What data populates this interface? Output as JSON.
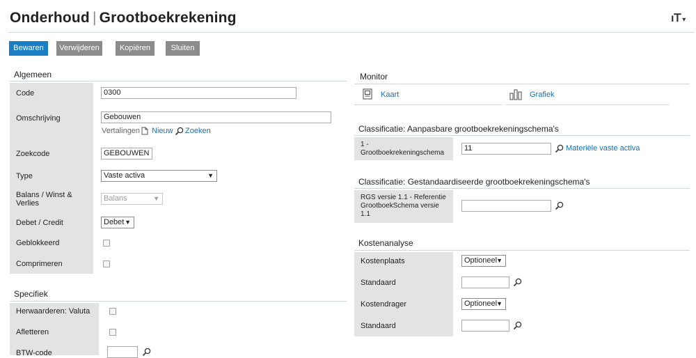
{
  "header": {
    "title_part1": "Onderhoud",
    "title_sep": "|",
    "title_part2": "Grootboekrekening",
    "tools_icon": "settings-tools-icon",
    "tools_caret": "▾"
  },
  "toolbar": {
    "save": "Bewaren",
    "delete": "Verwijderen",
    "copy": "Kopiëren",
    "close": "Sluiten"
  },
  "algemeen": {
    "title": "Algemeen",
    "code_label": "Code",
    "code_value": "0300",
    "omschrijving_label": "Omschrijving",
    "omschrijving_value": "Gebouwen",
    "vertalingen": "Vertalingen",
    "nieuw": "Nieuw",
    "zoeken": "Zoeken",
    "zoekcode_label": "Zoekcode",
    "zoekcode_value": "GEBOUWEN",
    "type_label": "Type",
    "type_value": "Vaste activa",
    "balans_label_1": "Balans / Winst &",
    "balans_label_2": "Verlies",
    "balans_value": "Balans",
    "debet_label": "Debet / Credit",
    "debet_value": "Debet",
    "geblokkeerd_label": "Geblokkeerd",
    "comprimeren_label": "Comprimeren"
  },
  "specifiek": {
    "title": "Specifiek",
    "herwaarderen_label": "Herwaarderen: Valuta",
    "afletteren_label": "Afletteren",
    "btw_label": "BTW-code"
  },
  "monitor": {
    "title": "Monitor",
    "kaart": "Kaart",
    "grafiek": "Grafiek"
  },
  "classificatie_aanpasbaar": {
    "title": "Classificatie: Aanpasbare grootboekrekeningschema's",
    "label_1": "1 -",
    "label_2": "Grootboekrekeningschema",
    "value": "11",
    "lookup_text": "Materiële vaste activa"
  },
  "classificatie_gestandaardiseerd": {
    "title": "Classificatie: Gestandaardiseerde grootboekrekeningschema's",
    "label_1": "RGS versie 1.1 - Referentie",
    "label_2": "GrootboekSchema versie",
    "label_3": "1.1"
  },
  "kostenanalyse": {
    "title": "Kostenanalyse",
    "kostenplaats_label": "Kostenplaats",
    "kostenplaats_value": "Optioneel",
    "standaard1_label": "Standaard",
    "kostendrager_label": "Kostendrager",
    "kostendrager_value": "Optioneel",
    "standaard2_label": "Standaard"
  },
  "colors": {
    "primary": "#1a7ec4",
    "secondary_button": "#8c8c8c",
    "label_bg": "#e3e3e3",
    "link": "#1a6fb3"
  }
}
